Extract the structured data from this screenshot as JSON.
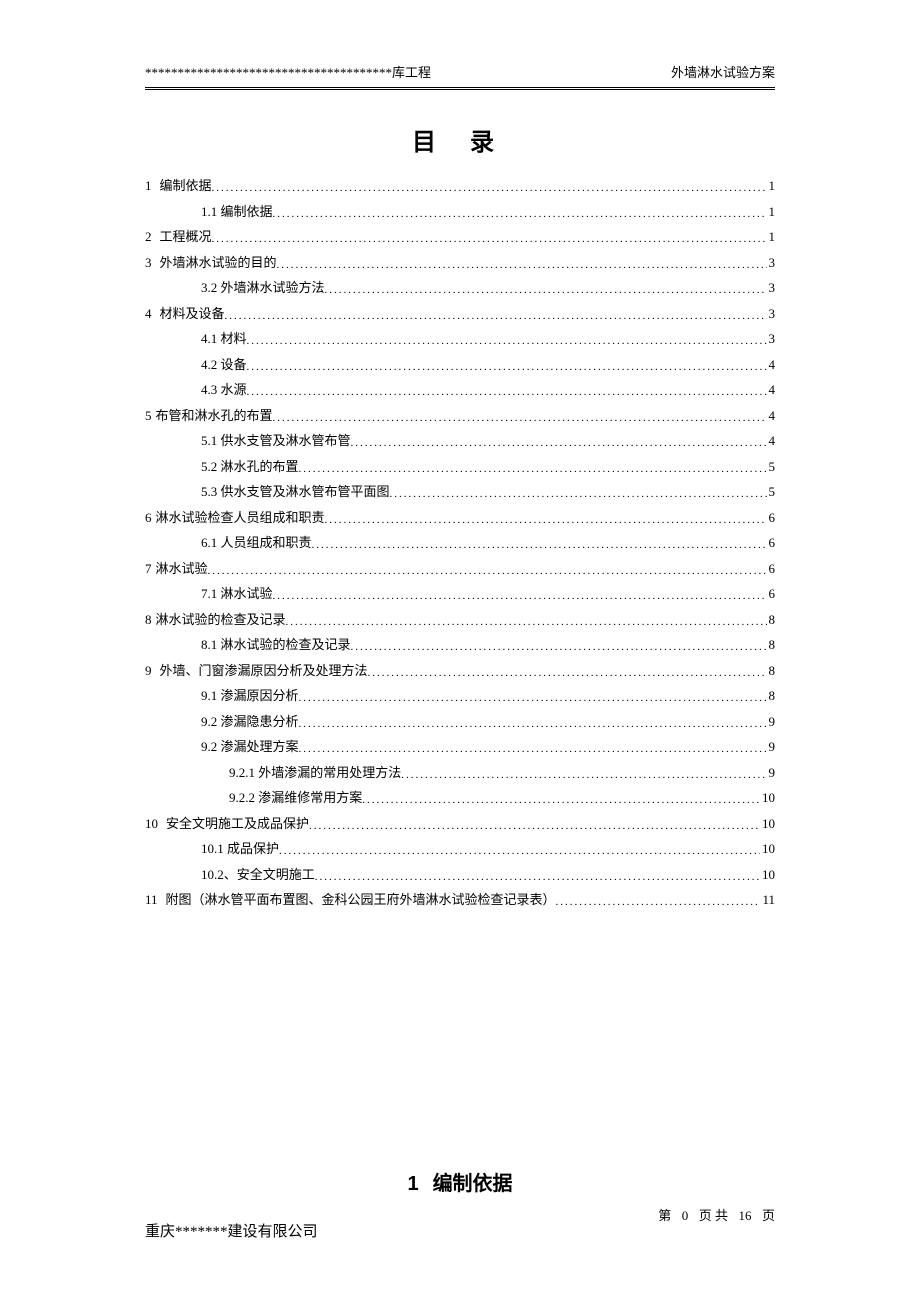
{
  "header": {
    "left": "**************************************库工程",
    "right": "外墙淋水试验方案"
  },
  "toc_title": "目 录",
  "toc": [
    {
      "level": 0,
      "num": "1",
      "text": "编制依据",
      "page": "1"
    },
    {
      "level": 1,
      "num": "",
      "text": "1.1 编制依据",
      "page": "1"
    },
    {
      "level": 0,
      "num": "2",
      "text": "工程概况",
      "page": "1"
    },
    {
      "level": 0,
      "num": "3",
      "text": "外墙淋水试验的目的",
      "page": "3"
    },
    {
      "level": 1,
      "num": "",
      "text": "3.2 外墙淋水试验方法",
      "page": "3"
    },
    {
      "level": 0,
      "num": "4",
      "text": "材料及设备",
      "page": "3"
    },
    {
      "level": 1,
      "num": "",
      "text": "4.1 材料",
      "page": "3"
    },
    {
      "level": 1,
      "num": "",
      "text": "4.2 设备",
      "page": "4"
    },
    {
      "level": 1,
      "num": "",
      "text": "4.3 水源",
      "page": "4"
    },
    {
      "level": 0,
      "num": "5",
      "text": "布管和淋水孔的布置",
      "page": "4",
      "nospace": true
    },
    {
      "level": 1,
      "num": "",
      "text": "5.1 供水支管及淋水管布管",
      "page": "4"
    },
    {
      "level": 1,
      "num": "",
      "text": "5.2 淋水孔的布置",
      "page": "5"
    },
    {
      "level": 1,
      "num": "",
      "text": "5.3 供水支管及淋水管布管平面图",
      "page": "5"
    },
    {
      "level": 0,
      "num": "6",
      "text": "淋水试验检查人员组成和职责",
      "page": "6",
      "nospace": true
    },
    {
      "level": 1,
      "num": "",
      "text": "6.1 人员组成和职责",
      "page": "6"
    },
    {
      "level": 0,
      "num": "7",
      "text": "淋水试验",
      "page": "6",
      "nospace": true
    },
    {
      "level": 1,
      "num": "",
      "text": "7.1 淋水试验",
      "page": "6"
    },
    {
      "level": 0,
      "num": "8",
      "text": "淋水试验的检查及记录",
      "page": "8",
      "nospace": true
    },
    {
      "level": 1,
      "num": "",
      "text": "8.1 淋水试验的检查及记录",
      "page": "8"
    },
    {
      "level": 0,
      "num": "9",
      "text": "外墙、门窗渗漏原因分析及处理方法",
      "page": "8"
    },
    {
      "level": 1,
      "num": "",
      "text": "9.1 渗漏原因分析",
      "page": "8"
    },
    {
      "level": 1,
      "num": "",
      "text": "9.2 渗漏隐患分析",
      "page": "9"
    },
    {
      "level": 1,
      "num": "",
      "text": "9.2 渗漏处理方案",
      "page": "9"
    },
    {
      "level": 2,
      "num": "",
      "text": "9.2.1 外墙渗漏的常用处理方法",
      "page": "9"
    },
    {
      "level": 2,
      "num": "",
      "text": "9.2.2 渗漏维修常用方案",
      "page": "10"
    },
    {
      "level": 0,
      "num": "10",
      "text": "安全文明施工及成品保护",
      "page": "10"
    },
    {
      "level": 1,
      "num": "",
      "text": "10.1 成品保护",
      "page": "10"
    },
    {
      "level": 1,
      "num": "",
      "text": "10.2、安全文明施工",
      "page": "10"
    },
    {
      "level": 0,
      "num": "11",
      "text": "附图（淋水管平面布置图、金科公园王府外墙淋水试验检查记录表）",
      "page": "11"
    }
  ],
  "section": {
    "num": "1",
    "title": "编制依据"
  },
  "company": "重庆*******建设有限公司",
  "footer": {
    "prefix": "第",
    "current": "0",
    "mid": "页 共",
    "total": "16",
    "suffix": "页"
  }
}
